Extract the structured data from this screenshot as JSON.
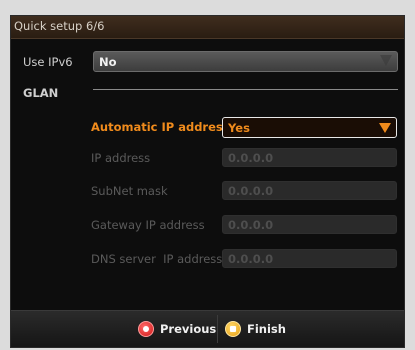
{
  "title": "Quick setup 6/6",
  "ipv6": {
    "label": "Use IPv6",
    "value": "No"
  },
  "glan": {
    "label": "GLAN"
  },
  "auto_ip": {
    "label": "Automatic IP address",
    "value": "Yes"
  },
  "fields": [
    {
      "label": "IP address",
      "value": "0.0.0.0"
    },
    {
      "label": "SubNet mask",
      "value": "0.0.0.0"
    },
    {
      "label": "Gateway IP address",
      "value": "0.0.0.0"
    },
    {
      "label": "DNS server  IP address",
      "value": "0.0.0.0"
    }
  ],
  "footer": {
    "previous_label": "Previous",
    "finish_label": "Finish"
  },
  "colors": {
    "accent": "#f08b1c",
    "previous_icon": "#d01818",
    "finish_icon": "#e6a013"
  }
}
